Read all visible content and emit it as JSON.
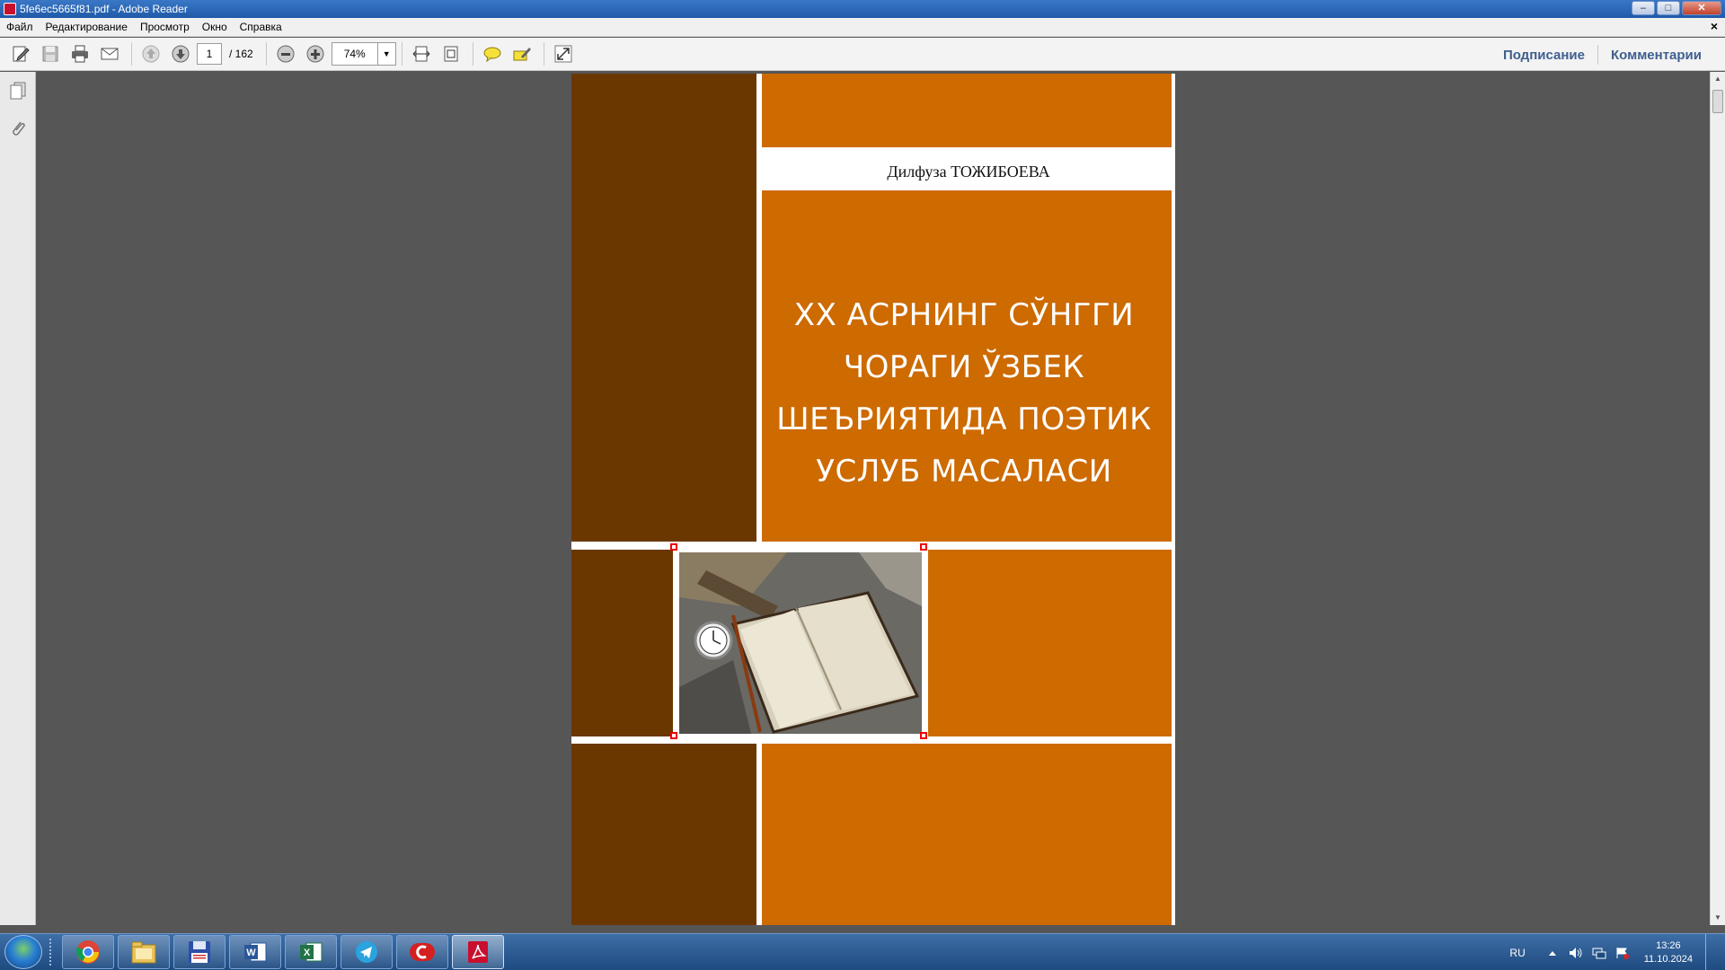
{
  "window": {
    "title": "5fe6ec5665f81.pdf - Adobe Reader",
    "controls": {
      "minimize": "–",
      "maximize": "□",
      "close": "✕"
    }
  },
  "menu": {
    "items": [
      "Файл",
      "Редактирование",
      "Просмотр",
      "Окно",
      "Справка"
    ],
    "close_doc": "×"
  },
  "toolbar": {
    "current_page": "1",
    "page_total": "/ 162",
    "zoom": "74%",
    "sign_label": "Подписание",
    "comment_label": "Комментарии"
  },
  "document": {
    "author": "Дилфуза ТОЖИБОЕВА",
    "title_lines": [
      "ХХ АСРНИНГ СЎНГГИ",
      "ЧОРАГИ ЎЗБЕК",
      "ШЕЪРИЯТИДА ПОЭТИК",
      "УСЛУБ МАСАЛАСИ"
    ],
    "colors": {
      "dark_brown": "#6b3700",
      "orange": "#cd6a00"
    }
  },
  "taskbar": {
    "apps": [
      "chrome-icon",
      "file-explorer-icon",
      "save-disk-icon",
      "word-icon",
      "excel-icon",
      "telegram-icon",
      "media-player-icon",
      "adobe-reader-icon"
    ],
    "active_app": "adobe-reader-icon",
    "language": "RU",
    "time": "13:26",
    "date": "11.10.2024"
  }
}
